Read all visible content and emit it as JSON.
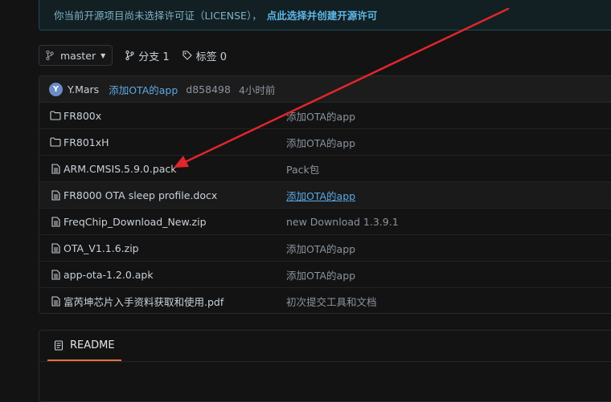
{
  "license_notice": {
    "text": "你当前开源项目尚未选择许可证（LICENSE），",
    "action": "点此选择并创建开源许可"
  },
  "toolbar": {
    "branch": "master",
    "branches_label": "分支 1",
    "tags_label": "标签 0"
  },
  "commit": {
    "avatar_letter": "Y",
    "author": "Y.Mars",
    "message": "添加OTA的app",
    "sha": "d858498",
    "time": "4小时前"
  },
  "files": [
    {
      "name": "FR800x",
      "type": "folder",
      "commit": "添加OTA的app"
    },
    {
      "name": "FR801xH",
      "type": "folder",
      "commit": "添加OTA的app"
    },
    {
      "name": "ARM.CMSIS.5.9.0.pack",
      "type": "file",
      "commit": "Pack包"
    },
    {
      "name": "FR8000 OTA sleep profile.docx",
      "type": "file",
      "commit": "添加OTA的app"
    },
    {
      "name": "FreqChip_Download_New.zip",
      "type": "file",
      "commit": "new Download 1.3.9.1"
    },
    {
      "name": "OTA_V1.1.6.zip",
      "type": "file",
      "commit": "添加OTA的app"
    },
    {
      "name": "app-ota-1.2.0.apk",
      "type": "file",
      "commit": "添加OTA的app"
    },
    {
      "name": "富芮坤芯片入手资料获取和使用.pdf",
      "type": "file",
      "commit": "初次提交工具和文档"
    }
  ],
  "readme": {
    "tab_label": "README"
  },
  "colors": {
    "annotation_arrow": "#e0262b",
    "link": "#5aa9e6",
    "accent_tab": "#e8713c"
  }
}
